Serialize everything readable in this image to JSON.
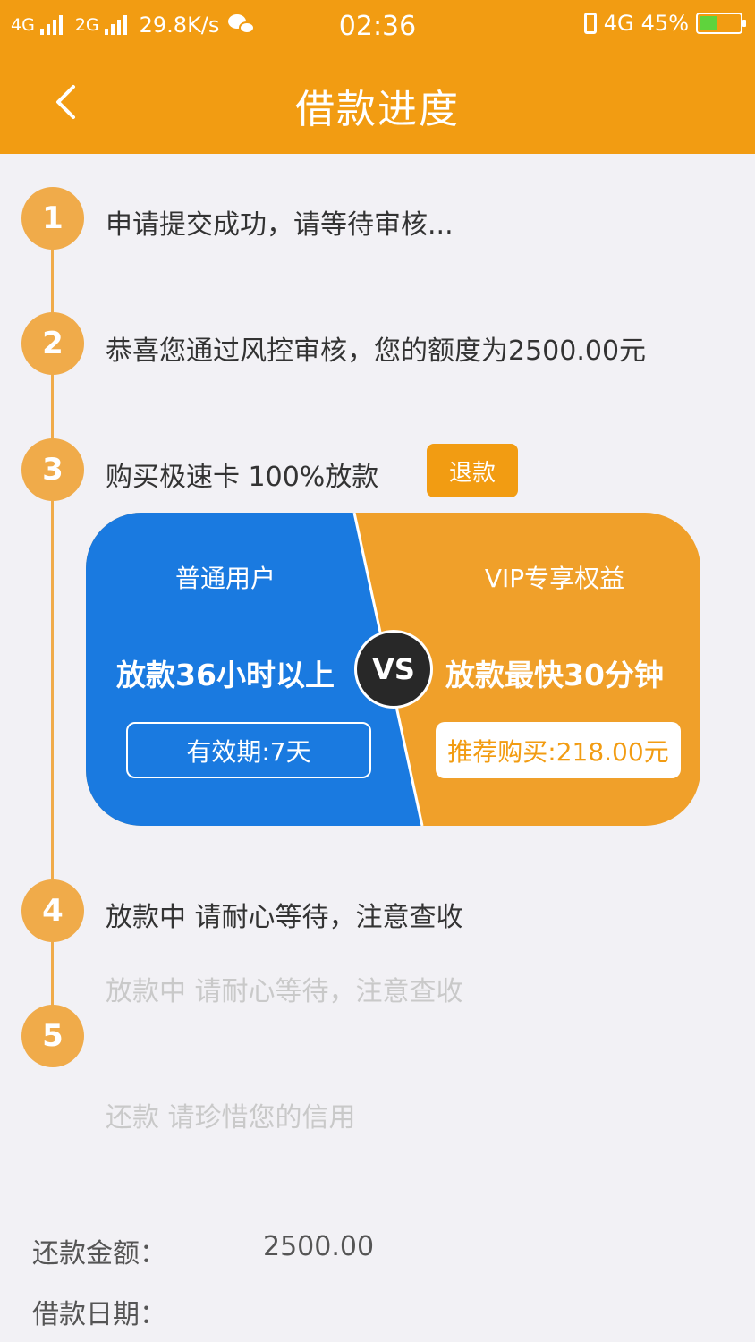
{
  "status_bar": {
    "network1": "4G",
    "network2": "2G",
    "speed": "29.8K/s",
    "time": "02:36",
    "network_right": "4G",
    "battery": "45%",
    "battery_level": 0.45
  },
  "header": {
    "title": "借款进度"
  },
  "steps": [
    {
      "num": "1",
      "text": "申请提交成功，请等待审核..."
    },
    {
      "num": "2",
      "text": "恭喜您通过风控审核，您的额度为2500.00元"
    },
    {
      "num": "3",
      "text": "购买极速卡 100%放款"
    },
    {
      "num": "4",
      "text": "放款中 请耐心等待，注意查收"
    },
    {
      "num": "5",
      "text": "还款 请珍惜您的信用"
    }
  ],
  "step4_subtext": "放款中 请耐心等待，注意查收",
  "refund_label": "退款",
  "card": {
    "normal_title": "普通用户",
    "normal_speed": "放款36小时以上",
    "normal_validity": "有效期:7天",
    "vs": "VS",
    "vip_title": "VIP专享权益",
    "vip_speed": "放款最快30分钟",
    "vip_buy": "推荐购买:218.00元"
  },
  "info": {
    "repay_label": "还款金额：",
    "repay_value": "2500.00",
    "date_label": "借款日期："
  },
  "colors": {
    "brand_orange": "#f29c12",
    "card_blue": "#1a7ae0",
    "card_orange": "#f0a02a",
    "timeline": "#f0ab4a",
    "background": "#f2f1f5"
  }
}
